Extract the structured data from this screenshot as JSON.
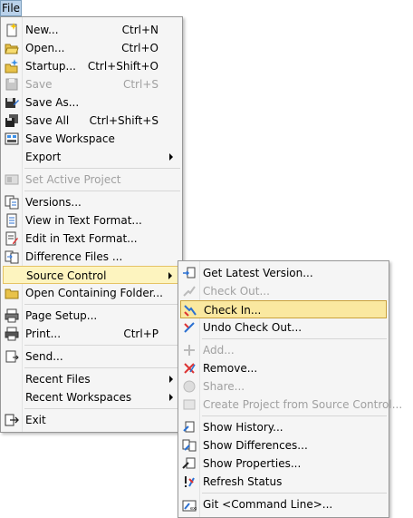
{
  "menubar": {
    "file_label": "File"
  },
  "file_menu": {
    "items": [
      {
        "label": "New...",
        "shortcut": "Ctrl+N",
        "icon": "new-file-icon"
      },
      {
        "label": "Open...",
        "shortcut": "Ctrl+O",
        "icon": "open-folder-icon"
      },
      {
        "label": "Startup...",
        "shortcut": "Ctrl+Shift+O",
        "icon": "startup-icon"
      },
      {
        "label": "Save",
        "shortcut": "Ctrl+S",
        "icon": "save-icon",
        "disabled": true
      },
      {
        "label": "Save As...",
        "shortcut": "",
        "icon": "save-as-icon"
      },
      {
        "label": "Save All",
        "shortcut": "Ctrl+Shift+S",
        "icon": "save-all-icon"
      },
      {
        "label": "Save Workspace",
        "shortcut": "",
        "icon": "save-workspace-icon"
      },
      {
        "label": "Export",
        "shortcut": "",
        "submenu": true
      },
      {
        "label": "Set Active Project",
        "shortcut": "",
        "icon": "set-active-project-icon",
        "disabled": true
      },
      {
        "label": "Versions...",
        "shortcut": "",
        "icon": "versions-icon"
      },
      {
        "label": "View in Text Format...",
        "shortcut": "",
        "icon": "view-text-icon"
      },
      {
        "label": "Edit in Text Format...",
        "shortcut": "",
        "icon": "edit-text-icon"
      },
      {
        "label": "Difference Files ...",
        "shortcut": "",
        "icon": "difference-files-icon"
      },
      {
        "label": "Source Control",
        "shortcut": "",
        "submenu": true,
        "highlighted": true
      },
      {
        "label": "Open Containing Folder...",
        "shortcut": "",
        "icon": "open-containing-folder-icon"
      },
      {
        "label": "Page Setup...",
        "shortcut": "",
        "icon": "page-setup-icon"
      },
      {
        "label": "Print...",
        "shortcut": "Ctrl+P",
        "icon": "print-icon"
      },
      {
        "label": "Send...",
        "shortcut": "",
        "icon": "send-icon"
      },
      {
        "label": "Recent Files",
        "shortcut": "",
        "submenu": true
      },
      {
        "label": "Recent Workspaces",
        "shortcut": "",
        "submenu": true
      },
      {
        "label": "Exit",
        "shortcut": "",
        "icon": "exit-icon"
      }
    ]
  },
  "source_control_menu": {
    "items": [
      {
        "label": "Get Latest Version...",
        "icon": "get-latest-icon"
      },
      {
        "label": "Check Out...",
        "icon": "check-out-icon",
        "disabled": true
      },
      {
        "label": "Check In...",
        "icon": "check-in-icon",
        "highlighted": true
      },
      {
        "label": "Undo Check Out...",
        "icon": "undo-check-out-icon"
      },
      {
        "label": "Add...",
        "icon": "add-icon",
        "disabled": true
      },
      {
        "label": "Remove...",
        "icon": "remove-icon"
      },
      {
        "label": "Share...",
        "icon": "share-icon",
        "disabled": true
      },
      {
        "label": "Create Project from Source Control...",
        "icon": "create-project-icon",
        "disabled": true
      },
      {
        "label": "Show History...",
        "icon": "show-history-icon"
      },
      {
        "label": "Show Differences...",
        "icon": "show-differences-icon"
      },
      {
        "label": "Show Properties...",
        "icon": "show-properties-icon"
      },
      {
        "label": "Refresh Status",
        "icon": "refresh-status-icon"
      },
      {
        "label": "Git <Command Line>...",
        "icon": "git-command-line-icon"
      }
    ]
  },
  "colors": {
    "menu_bg": "#f5f5f5",
    "highlight_bg": "#fdf4bf",
    "highlight_border": "#e5c365",
    "disabled_text": "#a0a0a0"
  }
}
